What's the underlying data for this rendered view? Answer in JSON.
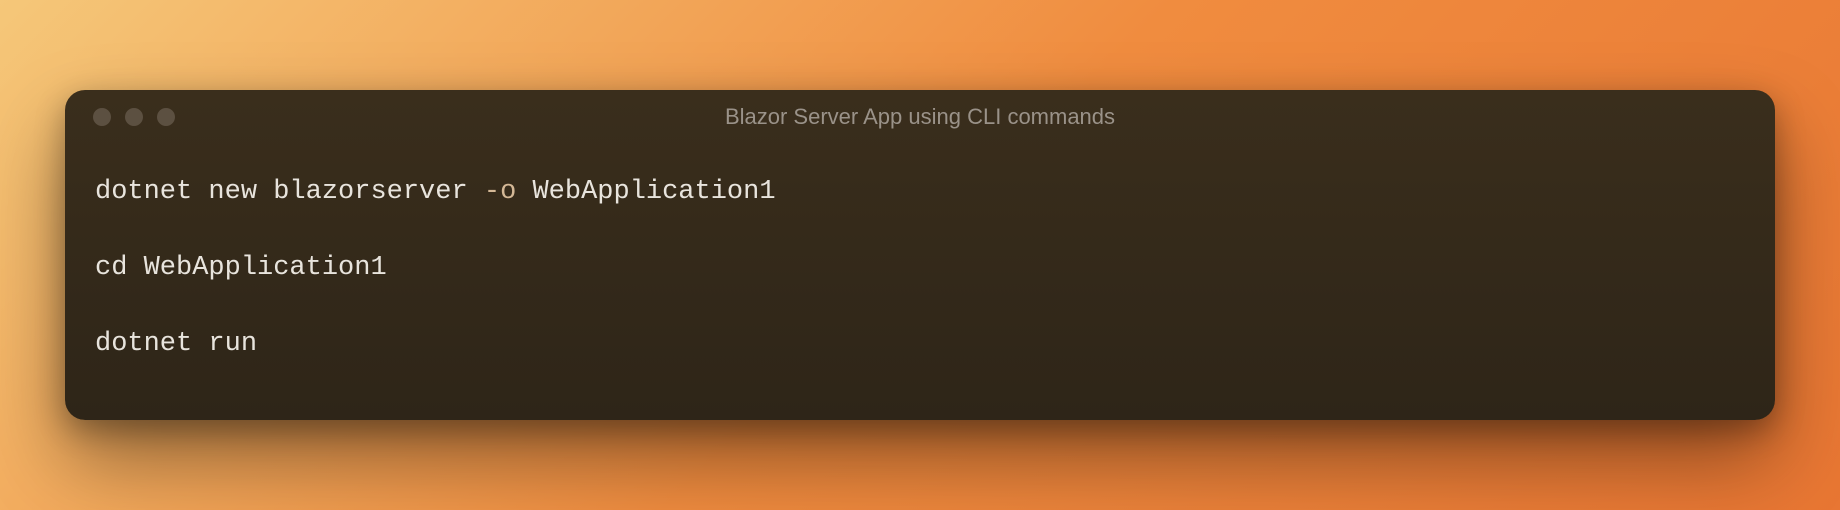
{
  "window": {
    "title": "Blazor Server App using CLI commands"
  },
  "code": {
    "lines": [
      {
        "tokens": [
          {
            "text": "dotnet new blazorserver ",
            "type": "plain"
          },
          {
            "text": "-o",
            "type": "flag"
          },
          {
            "text": " WebApplication1",
            "type": "plain"
          }
        ]
      },
      {
        "tokens": [
          {
            "text": "cd WebApplication1",
            "type": "plain"
          }
        ]
      },
      {
        "tokens": [
          {
            "text": "dotnet run",
            "type": "plain"
          }
        ]
      }
    ]
  }
}
